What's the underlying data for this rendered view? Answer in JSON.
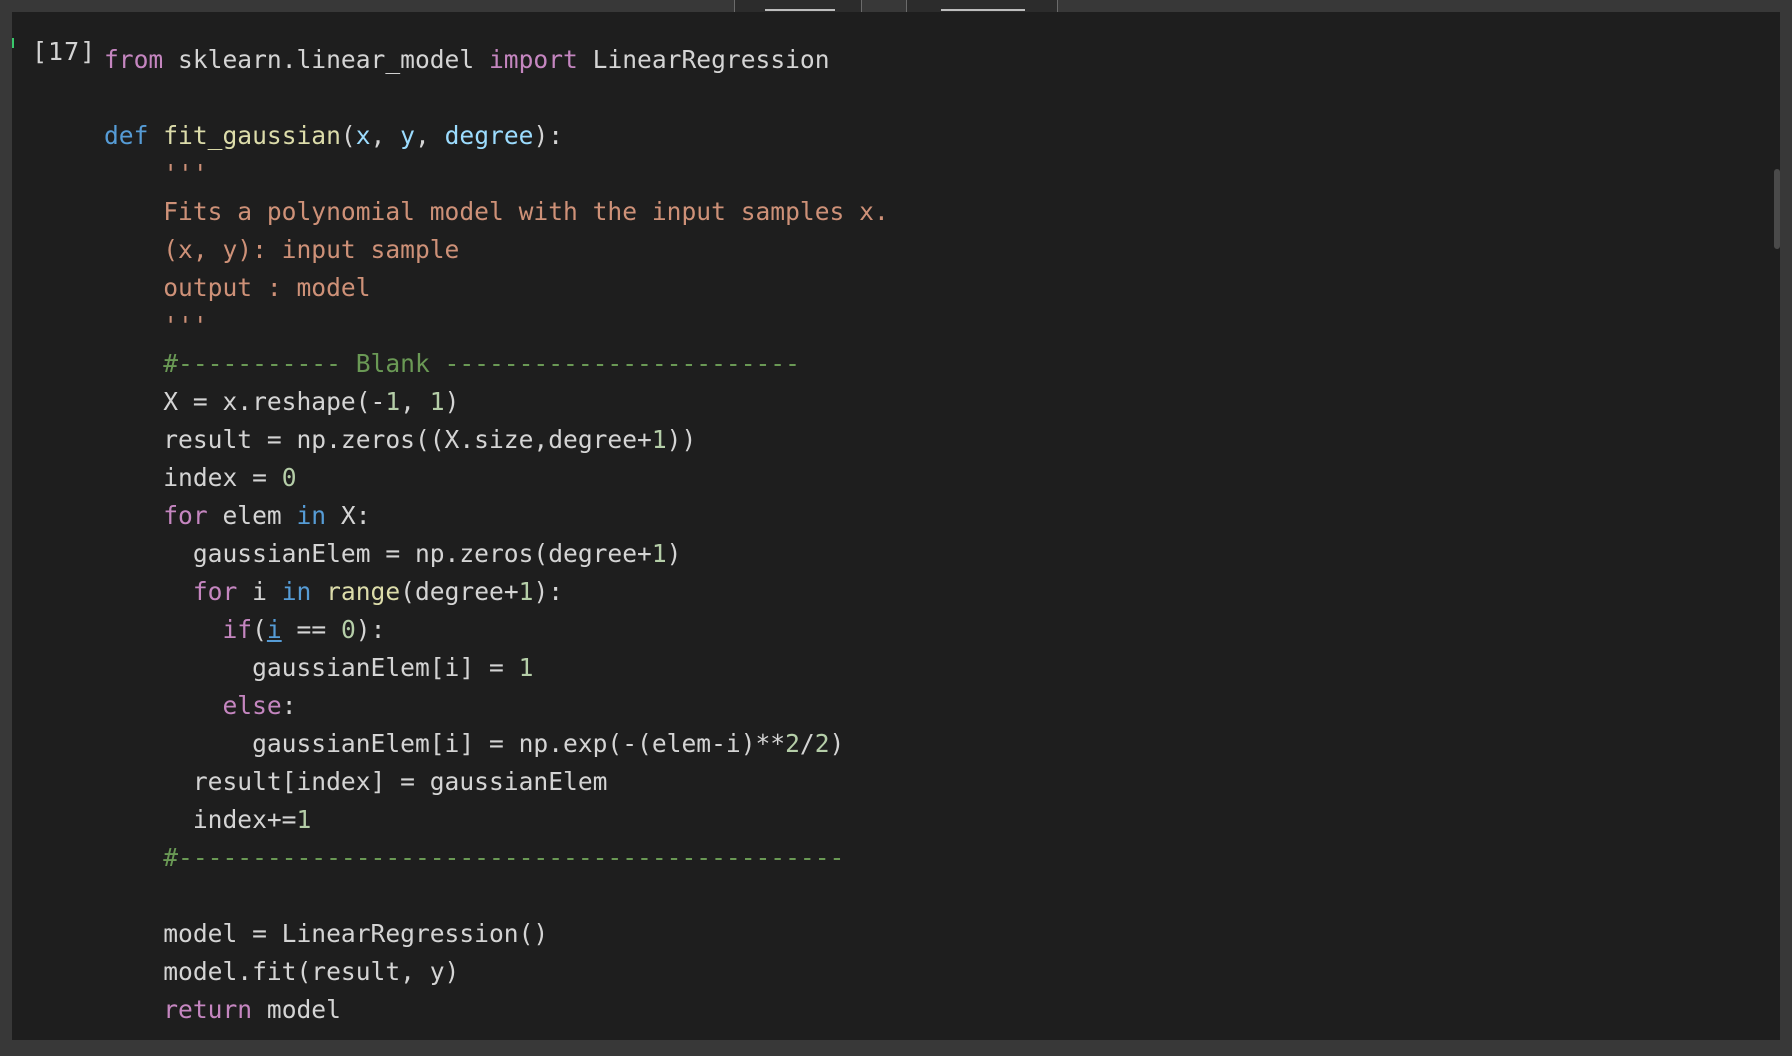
{
  "cell": {
    "execution_count": "[17]",
    "lines": [
      [
        {
          "t": "from",
          "c": "kw"
        },
        {
          "t": " sklearn.linear_model ",
          "c": ""
        },
        {
          "t": "import",
          "c": "kw"
        },
        {
          "t": " LinearRegression",
          "c": ""
        }
      ],
      [],
      [
        {
          "t": "def",
          "c": "def"
        },
        {
          "t": " ",
          "c": ""
        },
        {
          "t": "fit_gaussian",
          "c": "fn"
        },
        {
          "t": "(",
          "c": ""
        },
        {
          "t": "x",
          "c": "param"
        },
        {
          "t": ", ",
          "c": ""
        },
        {
          "t": "y",
          "c": "param"
        },
        {
          "t": ", ",
          "c": ""
        },
        {
          "t": "degree",
          "c": "param"
        },
        {
          "t": "):",
          "c": ""
        }
      ],
      [
        {
          "t": "    '''",
          "c": "str"
        }
      ],
      [
        {
          "t": "    Fits a polynomial model with the input samples x.",
          "c": "str"
        }
      ],
      [
        {
          "t": "    (x, y): input sample",
          "c": "str"
        }
      ],
      [
        {
          "t": "    output : model",
          "c": "str"
        }
      ],
      [
        {
          "t": "    '''",
          "c": "str"
        }
      ],
      [
        {
          "t": "    #----------- Blank ------------------------",
          "c": "cmt"
        }
      ],
      [
        {
          "t": "    X = x.reshape(-",
          "c": ""
        },
        {
          "t": "1",
          "c": "num"
        },
        {
          "t": ", ",
          "c": ""
        },
        {
          "t": "1",
          "c": "num"
        },
        {
          "t": ")",
          "c": ""
        }
      ],
      [
        {
          "t": "    result = np.zeros((X.size,degree+",
          "c": ""
        },
        {
          "t": "1",
          "c": "num"
        },
        {
          "t": "))",
          "c": ""
        }
      ],
      [
        {
          "t": "    index = ",
          "c": ""
        },
        {
          "t": "0",
          "c": "num"
        }
      ],
      [
        {
          "t": "    ",
          "c": ""
        },
        {
          "t": "for",
          "c": "kw"
        },
        {
          "t": " elem ",
          "c": ""
        },
        {
          "t": "in",
          "c": "def"
        },
        {
          "t": " X:",
          "c": ""
        }
      ],
      [
        {
          "t": "      gaussianElem = np.zeros(degree+",
          "c": ""
        },
        {
          "t": "1",
          "c": "num"
        },
        {
          "t": ")",
          "c": ""
        }
      ],
      [
        {
          "t": "      ",
          "c": ""
        },
        {
          "t": "for",
          "c": "kw"
        },
        {
          "t": " i ",
          "c": ""
        },
        {
          "t": "in",
          "c": "def"
        },
        {
          "t": " ",
          "c": ""
        },
        {
          "t": "range",
          "c": "fn"
        },
        {
          "t": "(degree+",
          "c": ""
        },
        {
          "t": "1",
          "c": "num"
        },
        {
          "t": "):",
          "c": ""
        }
      ],
      [
        {
          "t": "        ",
          "c": ""
        },
        {
          "t": "if",
          "c": "kw"
        },
        {
          "t": "(",
          "c": ""
        },
        {
          "t": "i",
          "c": "link"
        },
        {
          "t": " == ",
          "c": ""
        },
        {
          "t": "0",
          "c": "num"
        },
        {
          "t": "):",
          "c": ""
        }
      ],
      [
        {
          "t": "          gaussianElem[i] = ",
          "c": ""
        },
        {
          "t": "1",
          "c": "num"
        }
      ],
      [
        {
          "t": "        ",
          "c": ""
        },
        {
          "t": "else",
          "c": "kw"
        },
        {
          "t": ":",
          "c": ""
        }
      ],
      [
        {
          "t": "          gaussianElem[i] = np.exp(-(elem-i)**",
          "c": ""
        },
        {
          "t": "2",
          "c": "num"
        },
        {
          "t": "/",
          "c": ""
        },
        {
          "t": "2",
          "c": "num"
        },
        {
          "t": ")",
          "c": ""
        }
      ],
      [
        {
          "t": "      result[index] = gaussianElem",
          "c": ""
        }
      ],
      [
        {
          "t": "      index+=",
          "c": ""
        },
        {
          "t": "1",
          "c": "num"
        }
      ],
      [
        {
          "t": "    #---------------------------------------------",
          "c": "cmt"
        }
      ],
      [],
      [
        {
          "t": "    model = LinearRegression()",
          "c": ""
        }
      ],
      [
        {
          "t": "    model.fit(result, y)",
          "c": ""
        }
      ],
      [
        {
          "t": "    ",
          "c": ""
        },
        {
          "t": "return",
          "c": "kw"
        },
        {
          "t": " model",
          "c": ""
        }
      ]
    ]
  },
  "colors": {
    "background": "#1e1e1e",
    "keyword": "#c586c0",
    "def": "#569cd6",
    "function": "#dcdcaa",
    "param": "#9cdcfe",
    "string": "#ce9178",
    "comment": "#6a9955",
    "number": "#b5cea8"
  }
}
